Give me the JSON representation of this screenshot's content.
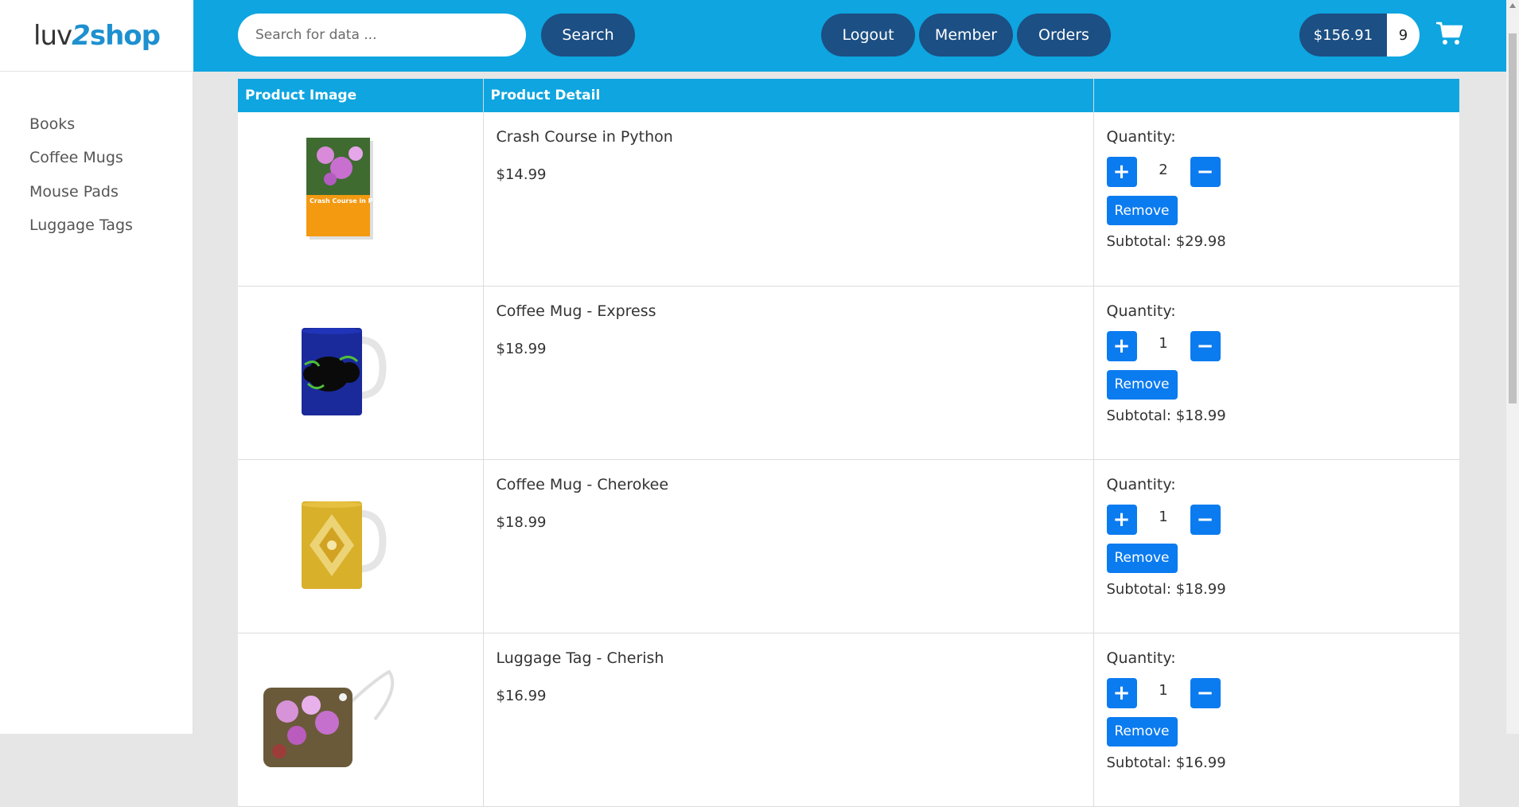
{
  "brand": {
    "part1": "luv",
    "part2": "2",
    "part3": "shop"
  },
  "sidebar": {
    "items": [
      {
        "label": "Books"
      },
      {
        "label": "Coffee Mugs"
      },
      {
        "label": "Mouse Pads"
      },
      {
        "label": "Luggage Tags"
      }
    ]
  },
  "header": {
    "search_placeholder": "Search for data ...",
    "search_label": "Search",
    "logout_label": "Logout",
    "member_label": "Member",
    "orders_label": "Orders",
    "cart_total": "$156.91",
    "cart_count": "9"
  },
  "table": {
    "headers": [
      "Product Image",
      "Product Detail",
      ""
    ],
    "rows": [
      {
        "name": "Crash Course in Python",
        "price": "$14.99",
        "qty_label": "Quantity:",
        "quantity": "2",
        "remove_label": "Remove",
        "subtotal": "Subtotal: $29.98",
        "image_text": "Crash Course in Python"
      },
      {
        "name": "Coffee Mug - Express",
        "price": "$18.99",
        "qty_label": "Quantity:",
        "quantity": "1",
        "remove_label": "Remove",
        "subtotal": "Subtotal: $18.99"
      },
      {
        "name": "Coffee Mug - Cherokee",
        "price": "$18.99",
        "qty_label": "Quantity:",
        "quantity": "1",
        "remove_label": "Remove",
        "subtotal": "Subtotal: $18.99"
      },
      {
        "name": "Luggage Tag - Cherish",
        "price": "$16.99",
        "qty_label": "Quantity:",
        "quantity": "1",
        "remove_label": "Remove",
        "subtotal": "Subtotal: $16.99"
      }
    ]
  },
  "colors": {
    "header_bg": "#0ea5e0",
    "pill_bg": "#1c4f83",
    "action_blue": "#0b7bf0",
    "page_bg": "#e6e6e6"
  }
}
